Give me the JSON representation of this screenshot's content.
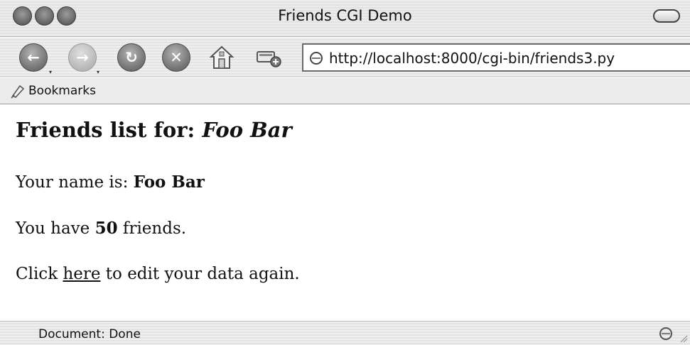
{
  "window": {
    "title": "Friends CGI Demo"
  },
  "toolbar": {
    "url": "http://localhost:8000/cgi-bin/friends3.py"
  },
  "bookmarks": {
    "label": "Bookmarks"
  },
  "content": {
    "heading_prefix": "Friends list for: ",
    "heading_name": "Foo Bar",
    "name_prefix": "Your name is: ",
    "name_value": "Foo Bar",
    "friends_prefix": "You have ",
    "friends_count": "50",
    "friends_suffix": " friends.",
    "click_prefix": "Click ",
    "click_link": "here",
    "click_suffix": " to edit your data again."
  },
  "status": {
    "text": "Document: Done"
  },
  "icons": {
    "back": "back-arrow-icon",
    "forward": "forward-arrow-icon",
    "reload": "reload-icon",
    "stop": "stop-icon",
    "home": "home-icon",
    "new_tab": "new-tab-icon",
    "site": "globe-icon",
    "bookmarks": "bookmark-icon"
  }
}
